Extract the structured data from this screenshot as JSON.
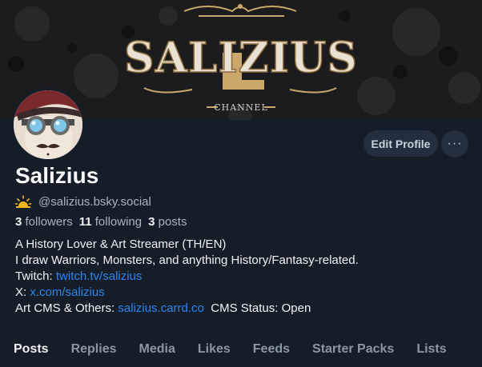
{
  "banner": {
    "logo_text": "SALIZIUS",
    "logo_sub": "CHANNEL"
  },
  "actions": {
    "edit_profile": "Edit Profile",
    "more": "···"
  },
  "profile": {
    "display_name": "Salizius",
    "handle": "@salizius.bsky.social",
    "followers_count": "3",
    "followers_label": "followers",
    "following_count": "11",
    "following_label": "following",
    "posts_count": "3",
    "posts_label": "posts"
  },
  "bio": {
    "line1": "A History Lover & Art Streamer (TH/EN)",
    "line2": "I draw Warriors, Monsters, and anything History/Fantasy-related.",
    "twitch_prefix": "Twitch: ",
    "twitch_link": "twitch.tv/salizius",
    "x_prefix": "X: ",
    "x_link": "x.com/salizius",
    "cms_prefix": "Art CMS & Others: ",
    "cms_link": "salizius.carrd.co",
    "cms_status": "CMS Status: Open"
  },
  "tabs": [
    "Posts",
    "Replies",
    "Media",
    "Likes",
    "Feeds",
    "Starter Packs",
    "Lists"
  ],
  "colors": {
    "background": "#151d28",
    "link": "#2b86f0",
    "button_bg": "#232e3e",
    "muted": "#aab4c1",
    "logo_gold": "#c9a86a"
  },
  "icons": {
    "badge": "sun-icon",
    "more": "ellipsis-icon"
  }
}
